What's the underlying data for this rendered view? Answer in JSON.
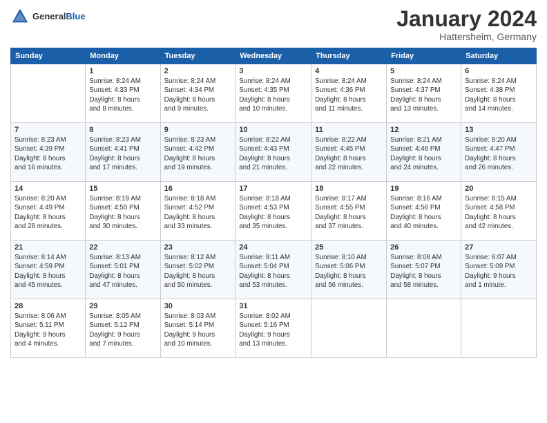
{
  "header": {
    "logo_general": "General",
    "logo_blue": "Blue",
    "month_title": "January 2024",
    "location": "Hattersheim, Germany"
  },
  "calendar": {
    "days_of_week": [
      "Sunday",
      "Monday",
      "Tuesday",
      "Wednesday",
      "Thursday",
      "Friday",
      "Saturday"
    ],
    "weeks": [
      [
        {
          "day": "",
          "info": ""
        },
        {
          "day": "1",
          "info": "Sunrise: 8:24 AM\nSunset: 4:33 PM\nDaylight: 8 hours\nand 8 minutes."
        },
        {
          "day": "2",
          "info": "Sunrise: 8:24 AM\nSunset: 4:34 PM\nDaylight: 8 hours\nand 9 minutes."
        },
        {
          "day": "3",
          "info": "Sunrise: 8:24 AM\nSunset: 4:35 PM\nDaylight: 8 hours\nand 10 minutes."
        },
        {
          "day": "4",
          "info": "Sunrise: 8:24 AM\nSunset: 4:36 PM\nDaylight: 8 hours\nand 11 minutes."
        },
        {
          "day": "5",
          "info": "Sunrise: 8:24 AM\nSunset: 4:37 PM\nDaylight: 8 hours\nand 13 minutes."
        },
        {
          "day": "6",
          "info": "Sunrise: 8:24 AM\nSunset: 4:38 PM\nDaylight: 8 hours\nand 14 minutes."
        }
      ],
      [
        {
          "day": "7",
          "info": "Sunrise: 8:23 AM\nSunset: 4:39 PM\nDaylight: 8 hours\nand 16 minutes."
        },
        {
          "day": "8",
          "info": "Sunrise: 8:23 AM\nSunset: 4:41 PM\nDaylight: 8 hours\nand 17 minutes."
        },
        {
          "day": "9",
          "info": "Sunrise: 8:23 AM\nSunset: 4:42 PM\nDaylight: 8 hours\nand 19 minutes."
        },
        {
          "day": "10",
          "info": "Sunrise: 8:22 AM\nSunset: 4:43 PM\nDaylight: 8 hours\nand 21 minutes."
        },
        {
          "day": "11",
          "info": "Sunrise: 8:22 AM\nSunset: 4:45 PM\nDaylight: 8 hours\nand 22 minutes."
        },
        {
          "day": "12",
          "info": "Sunrise: 8:21 AM\nSunset: 4:46 PM\nDaylight: 8 hours\nand 24 minutes."
        },
        {
          "day": "13",
          "info": "Sunrise: 8:20 AM\nSunset: 4:47 PM\nDaylight: 8 hours\nand 26 minutes."
        }
      ],
      [
        {
          "day": "14",
          "info": "Sunrise: 8:20 AM\nSunset: 4:49 PM\nDaylight: 8 hours\nand 28 minutes."
        },
        {
          "day": "15",
          "info": "Sunrise: 8:19 AM\nSunset: 4:50 PM\nDaylight: 8 hours\nand 30 minutes."
        },
        {
          "day": "16",
          "info": "Sunrise: 8:18 AM\nSunset: 4:52 PM\nDaylight: 8 hours\nand 33 minutes."
        },
        {
          "day": "17",
          "info": "Sunrise: 8:18 AM\nSunset: 4:53 PM\nDaylight: 8 hours\nand 35 minutes."
        },
        {
          "day": "18",
          "info": "Sunrise: 8:17 AM\nSunset: 4:55 PM\nDaylight: 8 hours\nand 37 minutes."
        },
        {
          "day": "19",
          "info": "Sunrise: 8:16 AM\nSunset: 4:56 PM\nDaylight: 8 hours\nand 40 minutes."
        },
        {
          "day": "20",
          "info": "Sunrise: 8:15 AM\nSunset: 4:58 PM\nDaylight: 8 hours\nand 42 minutes."
        }
      ],
      [
        {
          "day": "21",
          "info": "Sunrise: 8:14 AM\nSunset: 4:59 PM\nDaylight: 8 hours\nand 45 minutes."
        },
        {
          "day": "22",
          "info": "Sunrise: 8:13 AM\nSunset: 5:01 PM\nDaylight: 8 hours\nand 47 minutes."
        },
        {
          "day": "23",
          "info": "Sunrise: 8:12 AM\nSunset: 5:02 PM\nDaylight: 8 hours\nand 50 minutes."
        },
        {
          "day": "24",
          "info": "Sunrise: 8:11 AM\nSunset: 5:04 PM\nDaylight: 8 hours\nand 53 minutes."
        },
        {
          "day": "25",
          "info": "Sunrise: 8:10 AM\nSunset: 5:06 PM\nDaylight: 8 hours\nand 56 minutes."
        },
        {
          "day": "26",
          "info": "Sunrise: 8:08 AM\nSunset: 5:07 PM\nDaylight: 8 hours\nand 58 minutes."
        },
        {
          "day": "27",
          "info": "Sunrise: 8:07 AM\nSunset: 5:09 PM\nDaylight: 9 hours\nand 1 minute."
        }
      ],
      [
        {
          "day": "28",
          "info": "Sunrise: 8:06 AM\nSunset: 5:11 PM\nDaylight: 9 hours\nand 4 minutes."
        },
        {
          "day": "29",
          "info": "Sunrise: 8:05 AM\nSunset: 5:12 PM\nDaylight: 9 hours\nand 7 minutes."
        },
        {
          "day": "30",
          "info": "Sunrise: 8:03 AM\nSunset: 5:14 PM\nDaylight: 9 hours\nand 10 minutes."
        },
        {
          "day": "31",
          "info": "Sunrise: 8:02 AM\nSunset: 5:16 PM\nDaylight: 9 hours\nand 13 minutes."
        },
        {
          "day": "",
          "info": ""
        },
        {
          "day": "",
          "info": ""
        },
        {
          "day": "",
          "info": ""
        }
      ]
    ]
  }
}
